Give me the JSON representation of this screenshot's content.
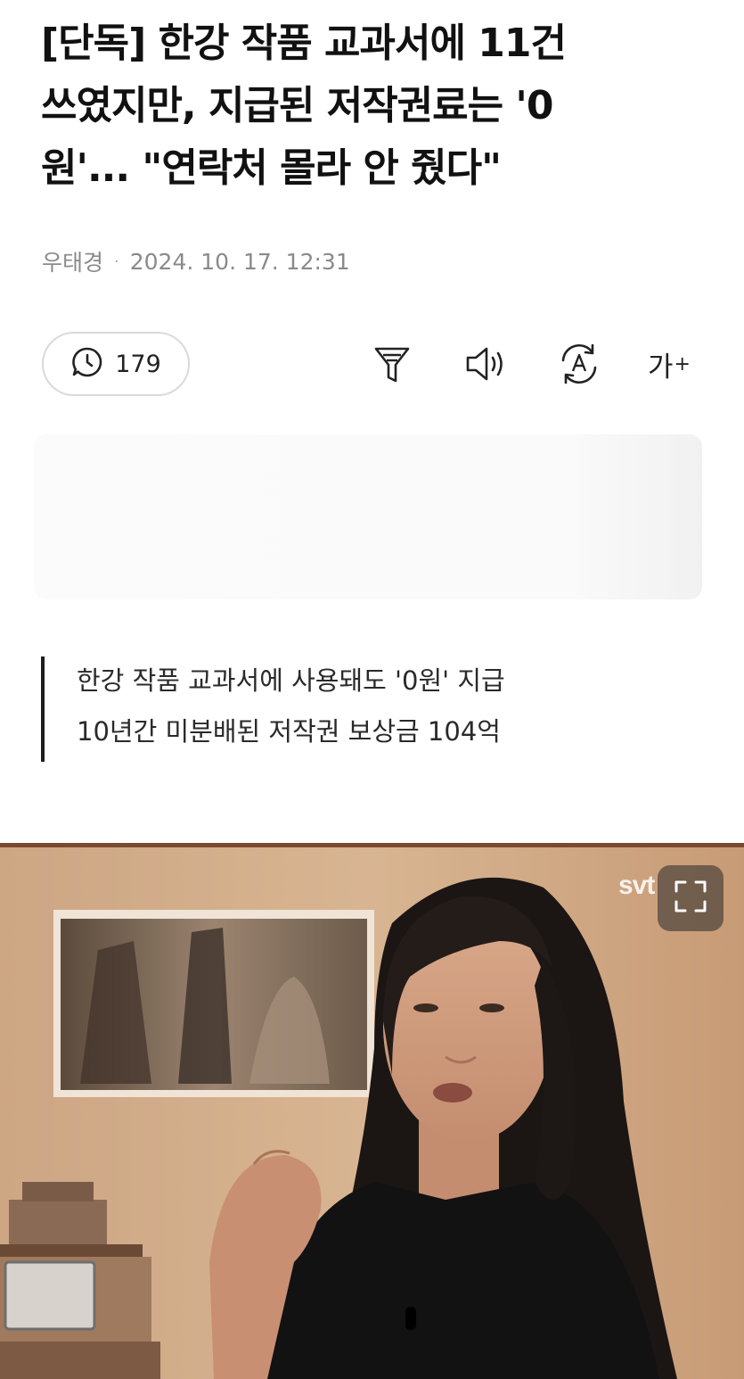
{
  "article": {
    "headline_line1": "[단독] 한강 작품 교과서에 11건",
    "headline_line2": "쓰였지만, 지급된 저작권료는 '0",
    "headline_line3": "원'... \"연락처 몰라 안 줬다\"",
    "author": "우태경",
    "separator": "·",
    "date": "2024. 10. 17. 12:31"
  },
  "toolbar": {
    "comment_count": "179",
    "font_size_label": "가",
    "font_size_plus": "+",
    "icons": [
      "comment-icon",
      "funnel-icon",
      "speaker-icon",
      "translate-icon",
      "font-size-icon"
    ]
  },
  "summary": {
    "line1": "한강 작품 교과서에 사용돼도 '0원' 지급",
    "line2": "10년간 미분배된 저작권 보상금 104억"
  },
  "photo": {
    "watermark": "svt",
    "fullscreen_icon": "fullscreen-icon"
  },
  "colors": {
    "headline": "#111111",
    "meta": "#8a8a8a",
    "summary_bar": "#1d1d1d",
    "pill_border": "#dadada"
  }
}
